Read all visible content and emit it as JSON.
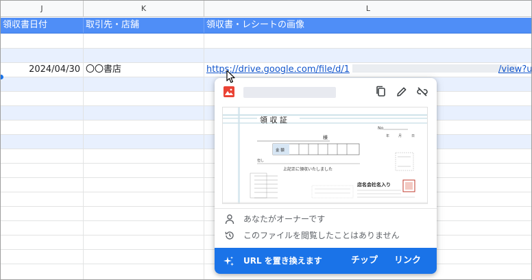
{
  "columns": {
    "j": "J",
    "k": "K",
    "l": "L"
  },
  "header_row": {
    "j": "領収書日付",
    "k": "取引先・店舗",
    "l": "領収書・レシートの画像"
  },
  "data_row": {
    "date": "2024/04/30",
    "store": "〇〇書店",
    "link_prefix": "https://drive.google.com/file/d/1",
    "link_suffix": "/view?u"
  },
  "chip": {
    "owner_text": "あなたがオーナーです",
    "viewed_text": "このファイルを閲覧したことはありません",
    "replace_label": "URL を置き換えます",
    "chip_label": "チップ",
    "link_label": "リンク"
  },
  "receipt": {
    "title": "領 収 証",
    "sama": "様",
    "amount_label": "金 額",
    "tadashi": "但し",
    "confirm": "上記正に領収いたしました",
    "no": "No",
    "date_units": [
      "年",
      "月",
      "日"
    ],
    "company": "店名会社名入り"
  },
  "colors": {
    "header_bg": "#4f8ef7",
    "band_bg": "#e8f0fe",
    "link": "#1155cc",
    "action_bar": "#1a73e8",
    "file_icon": "#ea4335"
  },
  "icons": [
    "image-file-icon",
    "copy-icon",
    "edit-pencil-icon",
    "unlink-icon",
    "person-icon",
    "history-icon",
    "sparkle-icon",
    "mouse-cursor-icon"
  ]
}
